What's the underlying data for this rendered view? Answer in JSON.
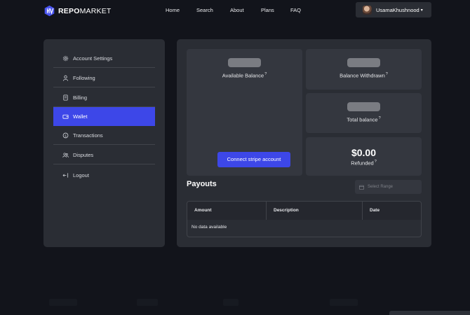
{
  "header": {
    "logo_bold": "REPO",
    "logo_light": "MARKET",
    "nav": [
      {
        "label": "Home"
      },
      {
        "label": "Search"
      },
      {
        "label": "About"
      },
      {
        "label": "Plans"
      },
      {
        "label": "FAQ"
      }
    ],
    "user": {
      "name": "UsamaKhushnood",
      "caret": "▾",
      "avatar_icon": "user-avatar"
    }
  },
  "sidebar": {
    "items": [
      {
        "label": "Account Settings",
        "icon": "gear-icon",
        "active": false
      },
      {
        "label": "Following",
        "icon": "user-icon",
        "active": false
      },
      {
        "label": "Billing",
        "icon": "receipt-icon",
        "active": false
      },
      {
        "label": "Wallet",
        "icon": "wallet-icon",
        "active": true
      },
      {
        "label": "Transactions",
        "icon": "dollar-circle-icon",
        "active": false
      },
      {
        "label": "Disputes",
        "icon": "people-icon",
        "active": false
      },
      {
        "label": "Logout",
        "icon": "logout-icon",
        "active": false
      }
    ]
  },
  "wallet": {
    "available_balance_label": "Available Balance",
    "balance_withdrawn_label": "Balance Withdrawn",
    "total_balance_label": "Total balance",
    "refunded_amount": "$0.00",
    "refunded_label": "Refunded",
    "info_glyph": "?",
    "connect_button": "Connect stripe account"
  },
  "payouts": {
    "title": "Payouts",
    "range_placeholder": "Select Range",
    "columns": [
      "Amount",
      "Description",
      "Date"
    ],
    "empty_text": "No data available"
  },
  "colors": {
    "background": "#12141b",
    "panel": "#2a2d34",
    "card": "#34373f",
    "accent": "#3d47e8"
  }
}
